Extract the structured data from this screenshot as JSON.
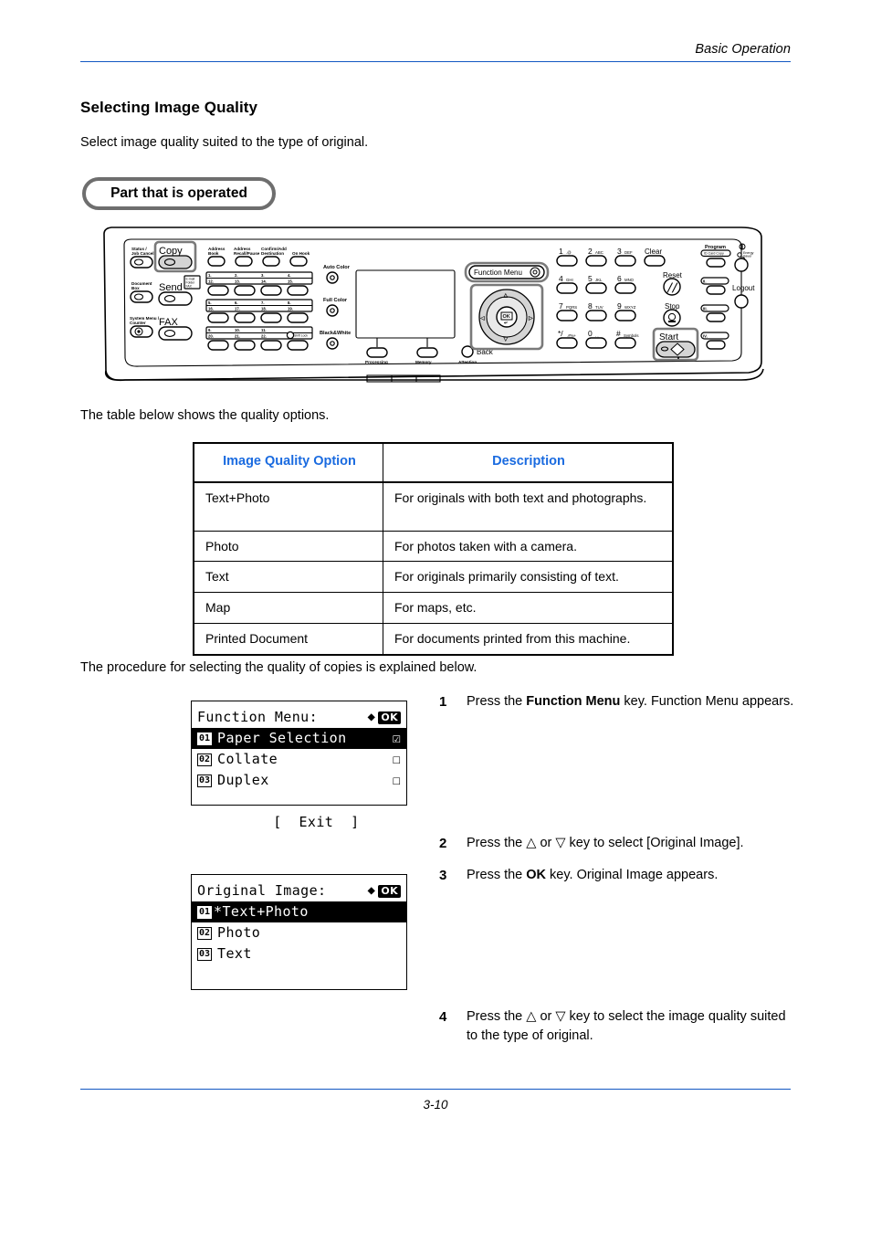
{
  "header": {
    "title": "Basic Operation",
    "rule_color": "#1257c2"
  },
  "section": {
    "title": "Selecting Image Quality",
    "intro": "Select image quality suited to the type of original.",
    "callout_label": "Part that is operated",
    "table_lead": "The table below shows the quality options.",
    "procedure_lead": "The procedure for selecting the quality of copies is explained below."
  },
  "table": {
    "headers": [
      "Image Quality Option",
      "Description"
    ],
    "header_color": "#1a6be0",
    "rows": [
      {
        "option": "Text+Photo",
        "description": "For originals with both text and photographs."
      },
      {
        "option": "Photo",
        "description": "For photos taken with a camera."
      },
      {
        "option": "Text",
        "description": "For originals primarily consisting of text."
      },
      {
        "option": "Map",
        "description": "For maps, etc."
      },
      {
        "option": "Printed Document",
        "description": "For documents printed from this machine."
      }
    ]
  },
  "lcd_function_menu": {
    "title": "Function Menu:",
    "ok_badge": "OK",
    "items": [
      {
        "num": "01",
        "label": "Paper Selection",
        "mark": "checked",
        "selected": true
      },
      {
        "num": "02",
        "label": "Collate",
        "mark": "unchecked",
        "selected": false
      },
      {
        "num": "03",
        "label": "Duplex",
        "mark": "unchecked",
        "selected": false
      }
    ],
    "footer": "[  Exit  ]"
  },
  "lcd_original_image": {
    "title": "Original Image:",
    "ok_badge": "OK",
    "items": [
      {
        "num": "01",
        "label": "*Text+Photo",
        "selected": true
      },
      {
        "num": "02",
        "label": "Photo",
        "selected": false
      },
      {
        "num": "03",
        "label": "Text",
        "selected": false
      }
    ]
  },
  "steps": [
    {
      "num": "1",
      "pre": "Press the ",
      "bold": "Function Menu",
      "post": " key. Function Menu appears."
    },
    {
      "num": "2",
      "pre": "Press the △ or ▽ key to select [Original Image].",
      "bold": "",
      "post": ""
    },
    {
      "num": "3",
      "pre": "Press the ",
      "bold": "OK",
      "post": " key. Original Image appears."
    },
    {
      "num": "4",
      "pre": "Press the △ or ▽ key to select the image quality suited to the type of original.",
      "bold": "",
      "post": ""
    }
  ],
  "control_panel": {
    "left_keys": [
      {
        "label": "Status /\nJob Cancel"
      },
      {
        "label": "Document\nBox"
      },
      {
        "label": "System Menu /\nCounter"
      }
    ],
    "mode_keys": [
      {
        "label": "Copy",
        "highlighted": true
      },
      {
        "label": "Send",
        "highlighted": false
      },
      {
        "label": "FAX",
        "highlighted": false
      }
    ],
    "send_sub_label": "E-mail\nFolder\nFAX",
    "address_keys": [
      "Address\nBook",
      "Address\nRecall/Pause",
      "Confirm/Add\nDestination",
      "On Hook"
    ],
    "one_touch_numbers": [
      "1.",
      "2.",
      "3.",
      "4.",
      "12.",
      "13.",
      "14.",
      "15.",
      "5.",
      "6.",
      "7.",
      "8.",
      "16.",
      "17.",
      "18.",
      "19.",
      "9.",
      "10.",
      "11.",
      "20.",
      "21.",
      "22."
    ],
    "shift_lock_label": "Shift Lock",
    "color_keys": [
      "Auto Color",
      "Full Color",
      "Black&White"
    ],
    "indicator_labels": [
      "Processing",
      "Memory",
      "Attention"
    ],
    "back_label": "Back",
    "function_menu_label": "Function Menu",
    "arrow_pad": {
      "up": "△",
      "down": "▽",
      "left": "◁",
      "right": "▷",
      "center": "OK"
    },
    "numpad": [
      {
        "big": "1",
        "small": ".@"
      },
      {
        "big": "2",
        "small": "ABC"
      },
      {
        "big": "3",
        "small": "DEF"
      },
      {
        "big": "4",
        "small": "GHI"
      },
      {
        "big": "5",
        "small": "JKL"
      },
      {
        "big": "6",
        "small": "MNO"
      },
      {
        "big": "7",
        "small": "PQRS"
      },
      {
        "big": "8",
        "small": "TUV"
      },
      {
        "big": "9",
        "small": "WXYZ"
      },
      {
        "big": "*/",
        "small": ".#%+"
      },
      {
        "big": "0",
        "small": ". ,"
      },
      {
        "big": "#",
        "small": "Symbols"
      }
    ],
    "clear_label": "Clear",
    "reset_label": "Reset",
    "stop_label": "Stop",
    "start_label": "Start",
    "program_label": "Program",
    "id_card_copy_label": "ID Card Copy",
    "energy_saver_label": "Energy\nSaver",
    "logout_label": "Logout",
    "program_slots": [
      "II.",
      "III.",
      "IV."
    ]
  },
  "footer": {
    "page": "3-10"
  }
}
